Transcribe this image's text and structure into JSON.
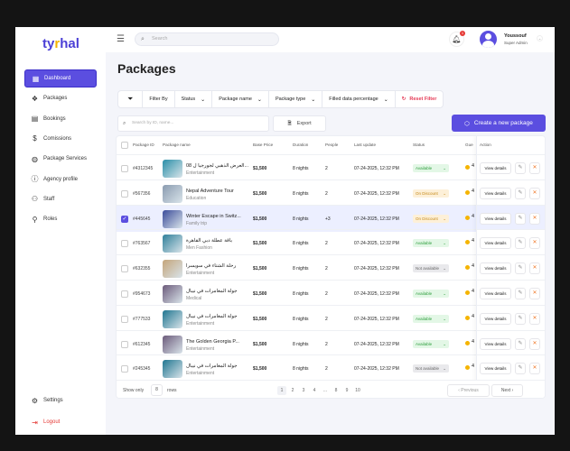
{
  "brand": {
    "logo": "tyrhal"
  },
  "sidebar": {
    "items": [
      {
        "label": "Dashboard",
        "icon": "grid-icon",
        "glyph": "▦"
      },
      {
        "label": "Packages",
        "icon": "packages-icon",
        "glyph": "❖"
      },
      {
        "label": "Bookings",
        "icon": "calendar-icon",
        "glyph": "▤"
      },
      {
        "label": "Comissions",
        "icon": "dollar-icon",
        "glyph": "$"
      },
      {
        "label": "Package Services",
        "icon": "globe-icon",
        "glyph": "◍"
      },
      {
        "label": "Agency profile",
        "icon": "info-icon",
        "glyph": "ⓘ"
      },
      {
        "label": "Staff",
        "icon": "staff-icon",
        "glyph": "⚇"
      },
      {
        "label": "Roles",
        "icon": "roles-icon",
        "glyph": "⚲"
      }
    ],
    "settings": "Settings",
    "logout": "Logout"
  },
  "header": {
    "search_placeholder": "Search",
    "notifications": "1",
    "user_name": "Youssouf",
    "user_role": "Super Admin"
  },
  "page": {
    "title": "Packages"
  },
  "filters": {
    "filter_by": "Filter By",
    "status": "Status",
    "package_name": "Package name",
    "package_type": "Package type",
    "filled": "Filled data percentage",
    "reset": "Reset Filter"
  },
  "toolbar": {
    "search_placeholder": "Search by ID, name...",
    "export": "Export",
    "create": "Create a new package"
  },
  "table": {
    "columns": [
      "Package ID",
      "Package name",
      "Base Price",
      "Duration",
      "People",
      "Last update",
      "Status",
      "Gue",
      "Action"
    ],
    "rows": [
      {
        "id": "#4312345",
        "name": "العرض الذهبي لجورجيا ل 08...",
        "cat": "Entertainment",
        "price": "$1,500",
        "duration": "8 nights",
        "people": "2",
        "updated": "07-24-2025, 12:32 PM",
        "status": "Available",
        "st": "a",
        "guest": "4",
        "selected": false,
        "img": "#2a8fa8"
      },
      {
        "id": "#567356",
        "name": "Nepal Adventure Tour",
        "cat": "Education",
        "price": "$1,500",
        "duration": "8 nights",
        "people": "2",
        "updated": "07-24-2025, 12:32 PM",
        "status": "On Discount",
        "st": "d",
        "guest": "4",
        "selected": false,
        "img": "#8a9bb0"
      },
      {
        "id": "#445645",
        "name": "Winter Escape in Switz...",
        "cat": "Family trip",
        "price": "$1,500",
        "duration": "8 nights",
        "people": "+3",
        "updated": "07-24-2025, 12:32 PM",
        "status": "On Discount",
        "st": "d",
        "guest": "4",
        "selected": true,
        "img": "#3b4c9a"
      },
      {
        "id": "#763567",
        "name": "باقة عطلة دبي القاهرة",
        "cat": "Men Fashion",
        "price": "$1,500",
        "duration": "8 nights",
        "people": "2",
        "updated": "07-24-2025, 12:32 PM",
        "status": "Available",
        "st": "a",
        "guest": "4",
        "selected": false,
        "img": "#2f7f9a"
      },
      {
        "id": "#632355",
        "name": "رحلة الشتاء في سويسرا",
        "cat": "Entertainment",
        "price": "$1,500",
        "duration": "8 nights",
        "people": "2",
        "updated": "07-24-2025, 12:32 PM",
        "status": "Not available",
        "st": "n",
        "guest": "4",
        "selected": false,
        "img": "#c4a57a"
      },
      {
        "id": "#954673",
        "name": "جولة المغامرات في نيبال",
        "cat": "Medical",
        "price": "$1,500",
        "duration": "8 nights",
        "people": "2",
        "updated": "07-24-2025, 12:32 PM",
        "status": "Available",
        "st": "a",
        "guest": "4",
        "selected": false,
        "img": "#6b5a7a"
      },
      {
        "id": "#777533",
        "name": "جولة المغامرات في نيبال",
        "cat": "Entertainment",
        "price": "$1,500",
        "duration": "8 nights",
        "people": "2",
        "updated": "07-24-2025, 12:32 PM",
        "status": "Available",
        "st": "a",
        "guest": "4",
        "selected": false,
        "img": "#1f7590"
      },
      {
        "id": "#612345",
        "name": "The Golden Georgia P...",
        "cat": "Entertainment",
        "price": "$1,500",
        "duration": "8 nights",
        "people": "2",
        "updated": "07-24-2025, 12:32 PM",
        "status": "Available",
        "st": "a",
        "guest": "4",
        "selected": false,
        "img": "#6b5a7a"
      },
      {
        "id": "#245345",
        "name": "جولة المغامرات في نيبال",
        "cat": "Entertainment",
        "price": "$1,500",
        "duration": "8 nights",
        "people": "2",
        "updated": "07-24-2025, 12:32 PM",
        "status": "Not available",
        "st": "n",
        "guest": "4",
        "selected": false,
        "img": "#1f7590"
      }
    ],
    "view_details": "View details"
  },
  "pagination": {
    "show_only": "Show only",
    "rows_value": "8",
    "rows": "rows",
    "pages": [
      "1",
      "2",
      "3",
      "4",
      "...",
      "8",
      "9",
      "10"
    ],
    "previous": "Previous",
    "next": "Next"
  }
}
